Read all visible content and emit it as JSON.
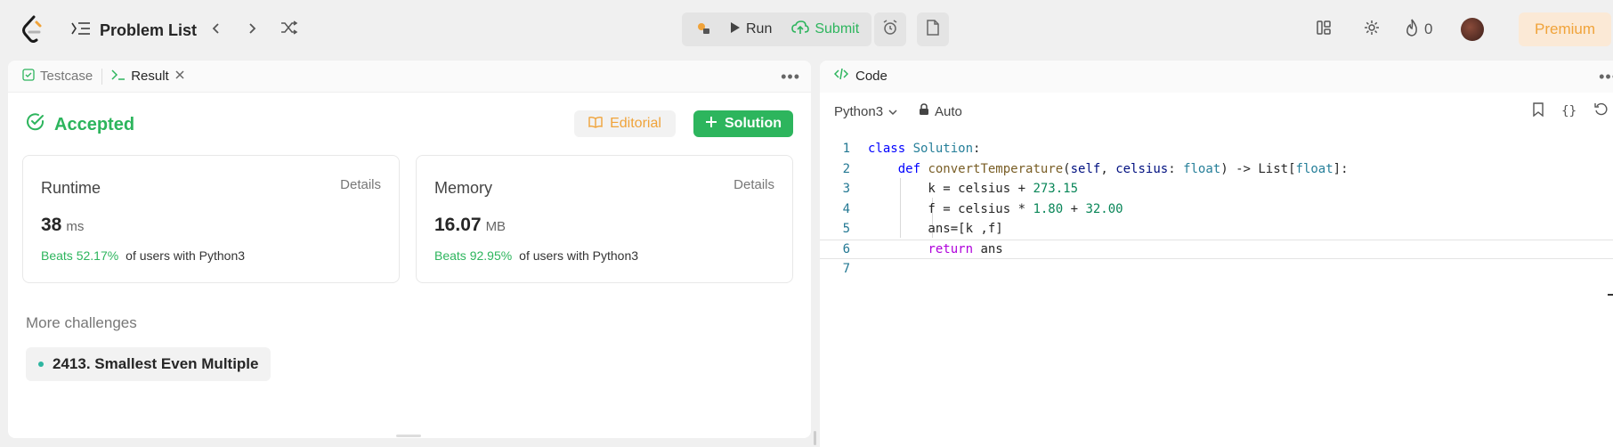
{
  "topbar": {
    "title": "Problem List",
    "run_label": "Run",
    "submit_label": "Submit",
    "streak_count": "0",
    "premium_label": "Premium"
  },
  "left_panel": {
    "tabs": [
      {
        "label": "Testcase"
      },
      {
        "label": "Result"
      }
    ],
    "status": "Accepted",
    "editorial_label": "Editorial",
    "solution_label": "Solution",
    "runtime": {
      "title": "Runtime",
      "details": "Details",
      "value": "38",
      "unit": "ms",
      "beats": "Beats 52.17%",
      "beats_suffix": "of users with Python3"
    },
    "memory": {
      "title": "Memory",
      "details": "Details",
      "value": "16.07",
      "unit": "MB",
      "beats": "Beats 92.95%",
      "beats_suffix": "of users with Python3"
    },
    "more_challenges_title": "More challenges",
    "challenges": [
      {
        "label": "2413. Smallest Even Multiple"
      }
    ]
  },
  "right_panel": {
    "tab_label": "Code",
    "language": "Python3",
    "mode": "Auto",
    "line_numbers": [
      "1",
      "2",
      "3",
      "4",
      "5",
      "6",
      "7"
    ],
    "code_lines": [
      "class Solution:",
      "    def convertTemperature(self, celsius: float) -> List[float]:",
      "        k = celsius + 273.15",
      "        f = celsius * 1.80 + 32.00",
      "        ans=[k ,f]",
      "        return ans",
      ""
    ]
  },
  "colors": {
    "accent_green": "#2db55d",
    "premium_orange": "#f0a33a",
    "editorial_orange": "#f0a33a"
  },
  "icons": [
    "logo-icon",
    "list-icon",
    "chevron-left-icon",
    "chevron-right-icon",
    "shuffle-icon",
    "debug-icon",
    "play-icon",
    "cloud-upload-icon",
    "alarm-icon",
    "note-icon",
    "layout-icon",
    "gear-icon",
    "fire-icon",
    "avatar",
    "testcase-check-icon",
    "terminal-icon",
    "close-icon",
    "check-circle-icon",
    "book-icon",
    "plus-icon",
    "code-icon",
    "chevron-down-icon",
    "lock-icon",
    "bookmark-icon",
    "braces-icon",
    "reset-icon"
  ]
}
